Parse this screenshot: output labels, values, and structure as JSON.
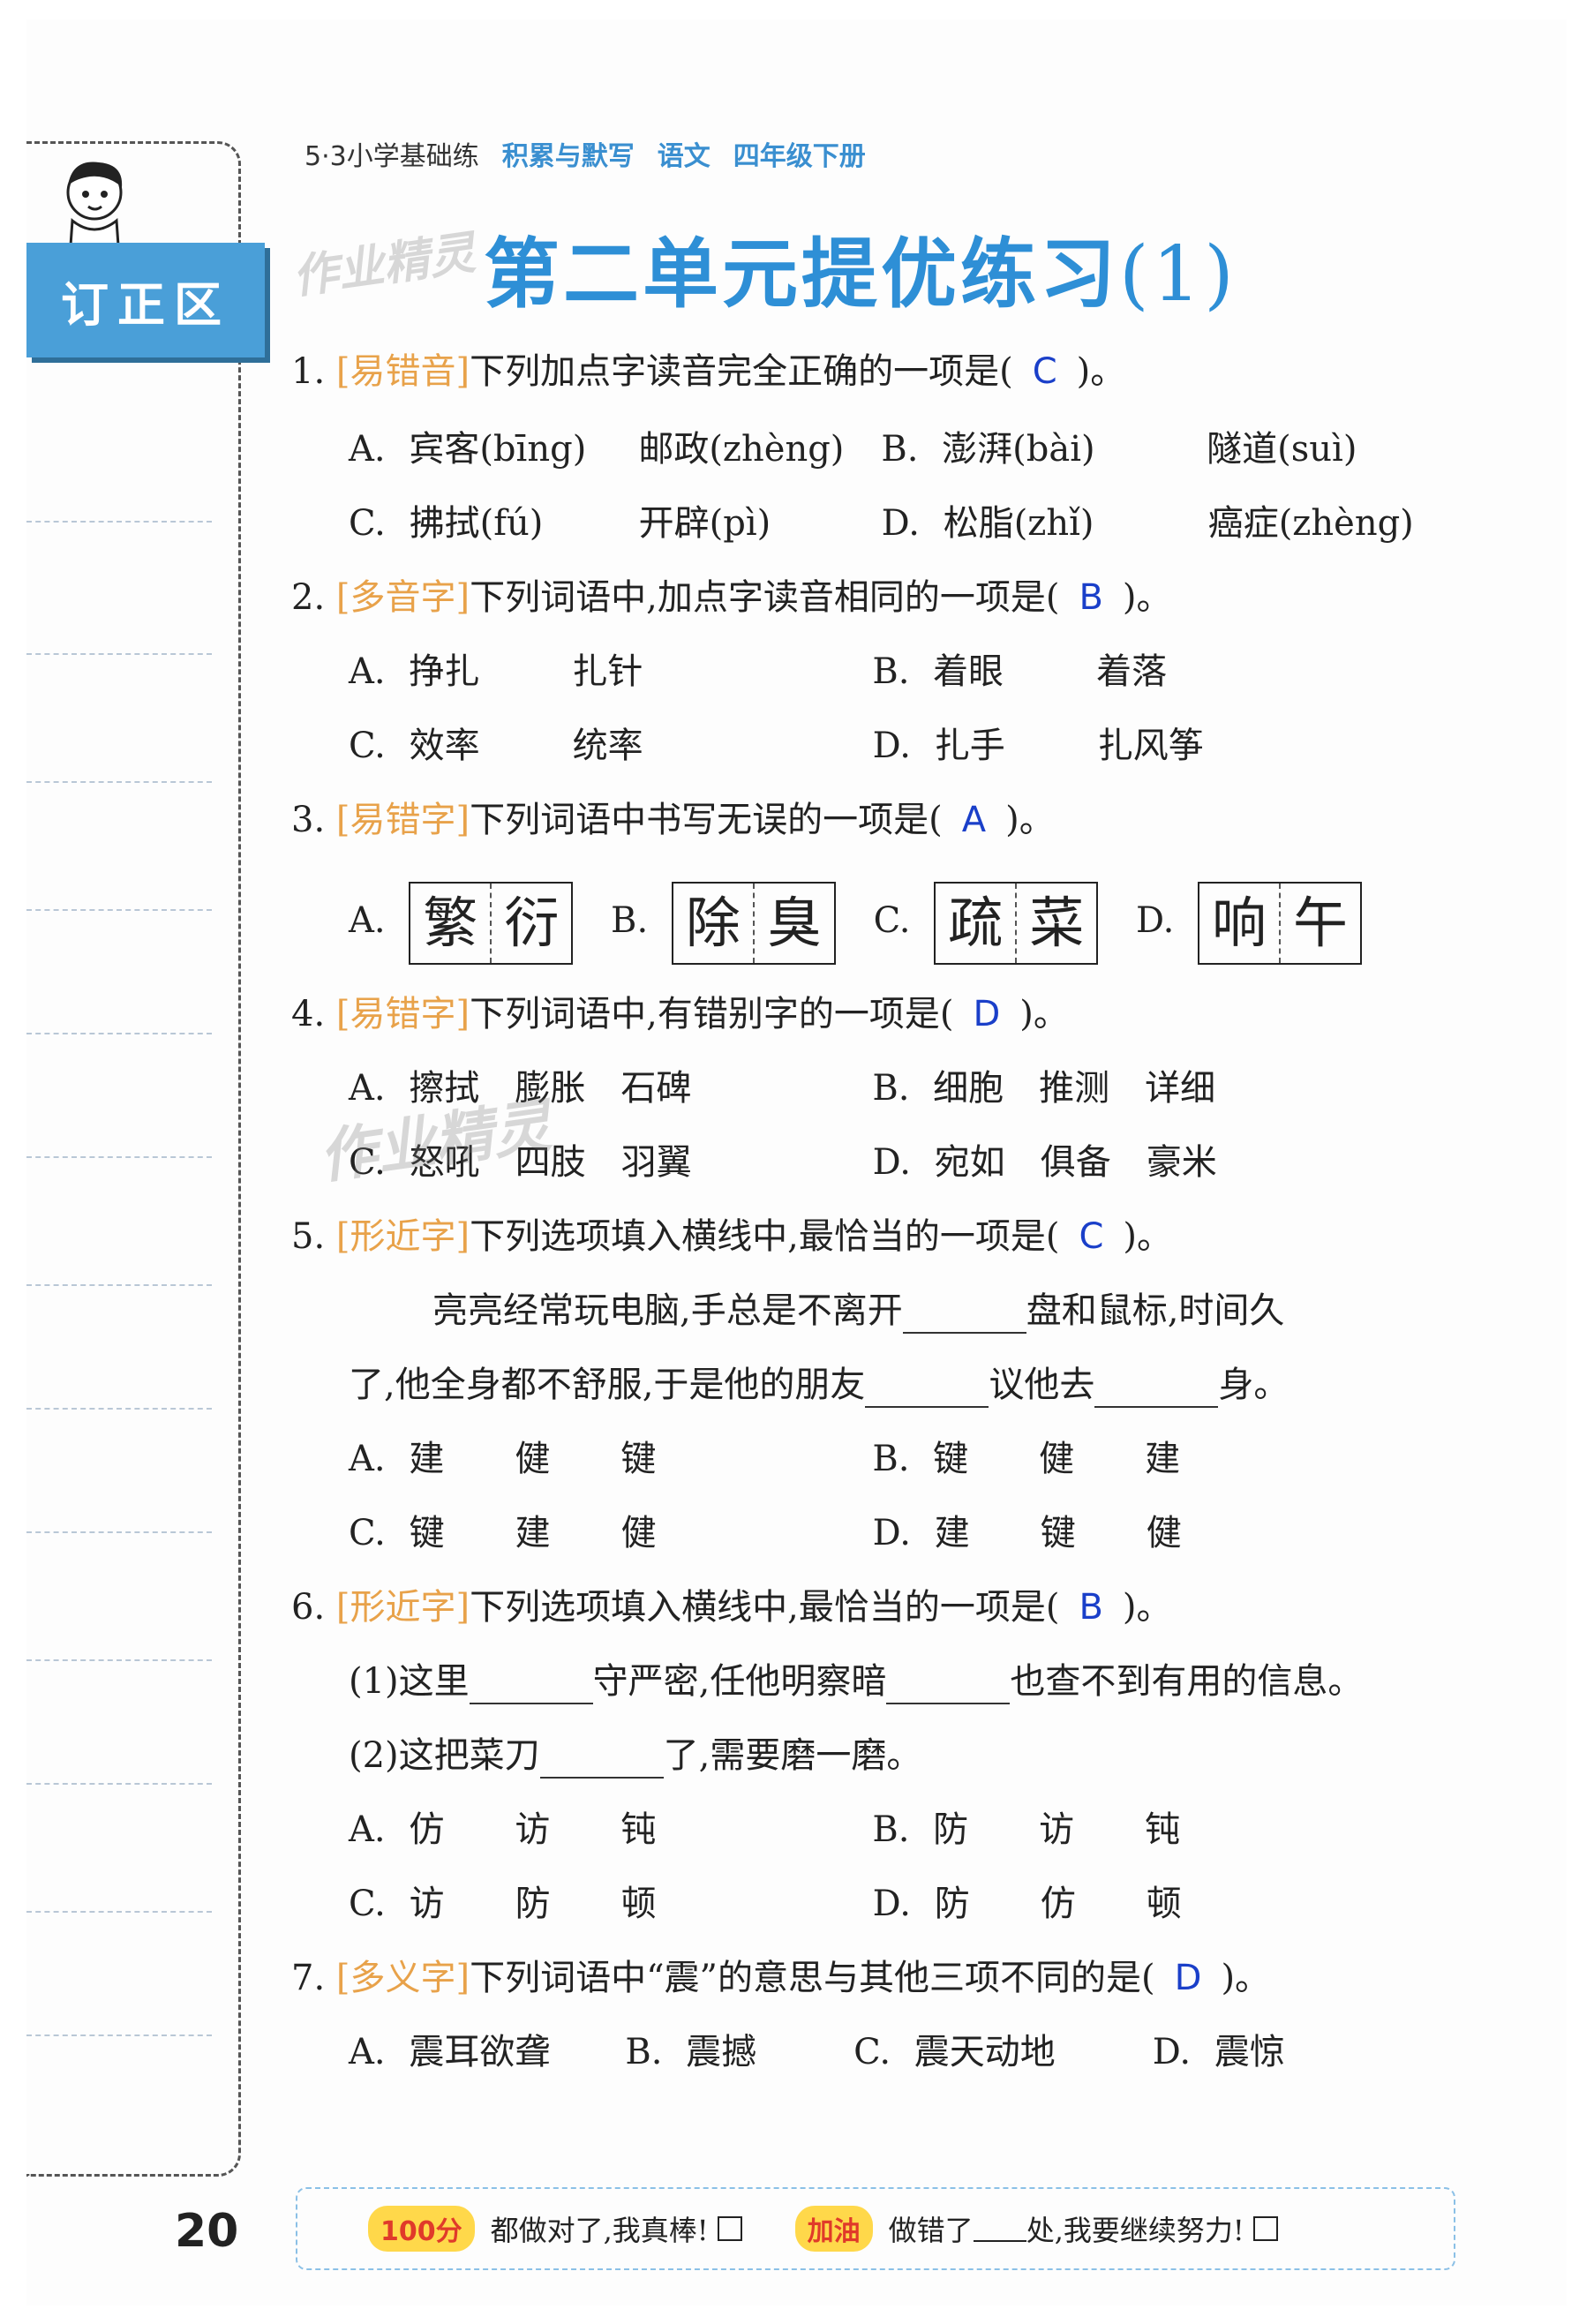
{
  "header": {
    "series": "5·3小学基础练",
    "book": "积累与默写",
    "subject": "语文",
    "grade": "四年级下册"
  },
  "sidebar": {
    "label": "订正区"
  },
  "watermark": "作业精灵",
  "title": {
    "main": "第二单元提优练习",
    "num": "(1)"
  },
  "questions": {
    "q1": {
      "num": "1.",
      "tag": "[易错音]",
      "text": "下列加点字读音完全正确的一项是(",
      "ans": "C",
      "end": ")。",
      "a1": "A.",
      "a1t": "宾客(bīng)",
      "a2t": "邮政(zhèng)",
      "b1": "B.",
      "b1t": "澎湃(bài)",
      "b2t": "隧道(suì)",
      "c1": "C.",
      "c1t": "拂拭(fú)",
      "c2t": "开辟(pì)",
      "d1": "D.",
      "d1t": "松脂(zhǐ)",
      "d2t": "癌症(zhèng)"
    },
    "q2": {
      "num": "2.",
      "tag": "[多音字]",
      "text": "下列词语中,加点字读音相同的一项是(",
      "ans": "B",
      "end": ")。",
      "a": "A.",
      "a1": "挣扎",
      "a2": "扎针",
      "b": "B.",
      "b1": "着眼",
      "b2": "着落",
      "c": "C.",
      "c1": "效率",
      "c2": "统率",
      "d": "D.",
      "d1": "扎手",
      "d2": "扎风筝"
    },
    "q3": {
      "num": "3.",
      "tag": "[易错字]",
      "text": "下列词语中书写无误的一项是(",
      "ans": "A",
      "end": ")。",
      "a": "A.",
      "a1": "繁",
      "a2": "衍",
      "b": "B.",
      "b1": "除",
      "b2": "臭",
      "c": "C.",
      "c1": "疏",
      "c2": "菜",
      "d": "D.",
      "d1": "响",
      "d2": "午"
    },
    "q4": {
      "num": "4.",
      "tag": "[易错字]",
      "text": "下列词语中,有错别字的一项是(",
      "ans": "D",
      "end": ")。",
      "a": "A.",
      "at": "擦拭　膨胀　石碑",
      "b": "B.",
      "bt": "细胞　推测　详细",
      "c": "C.",
      "ct": "怒吼　四肢　羽翼",
      "d": "D.",
      "dt": "宛如　俱备　豪米"
    },
    "q5": {
      "num": "5.",
      "tag": "[形近字]",
      "text": "下列选项填入横线中,最恰当的一项是(",
      "ans": "C",
      "end": ")。",
      "p1a": "亮亮经常玩电脑,手总是不离开",
      "p1b": "盘和鼠标,时间久",
      "p2a": "了,他全身都不舒服,于是他的朋友",
      "p2b": "议他去",
      "p2c": "身。",
      "a": "A.",
      "at": "建　　健　　键",
      "b": "B.",
      "bt": "键　　健　　建",
      "c": "C.",
      "ct": "键　　建　　健",
      "d": "D.",
      "dt": "建　　键　　健"
    },
    "q6": {
      "num": "6.",
      "tag": "[形近字]",
      "text": "下列选项填入横线中,最恰当的一项是(",
      "ans": "B",
      "end": ")。",
      "s1a": "(1)这里",
      "s1b": "守严密,任他明察暗",
      "s1c": "也查不到有用的信息。",
      "s2a": "(2)这把菜刀",
      "s2b": "了,需要磨一磨。",
      "a": "A.",
      "at": "仿　　访　　钝",
      "b": "B.",
      "bt": "防　　访　　钝",
      "c": "C.",
      "ct": "访　　防　　顿",
      "d": "D.",
      "dt": "防　　仿　　顿"
    },
    "q7": {
      "num": "7.",
      "tag": "[多义字]",
      "text": "下列词语中“震”的意思与其他三项不同的是(",
      "ans": "D",
      "end": ")。",
      "a": "A.",
      "at": "震耳欲聋",
      "b": "B.",
      "bt": "震撼",
      "c": "C.",
      "ct": "震天动地",
      "d": "D.",
      "dt": "震惊"
    }
  },
  "page_number": "20",
  "footer": {
    "badge1": "100分",
    "text1": "都做对了,我真棒!",
    "badge2": "加油",
    "text2a": "做错了",
    "text2b": "处,我要继续努力!"
  },
  "colors": {
    "accent": "#2e8fd6",
    "tag": "#e8a24a",
    "answer": "#1a3fc9",
    "sidebar": "#4a9fd8"
  }
}
